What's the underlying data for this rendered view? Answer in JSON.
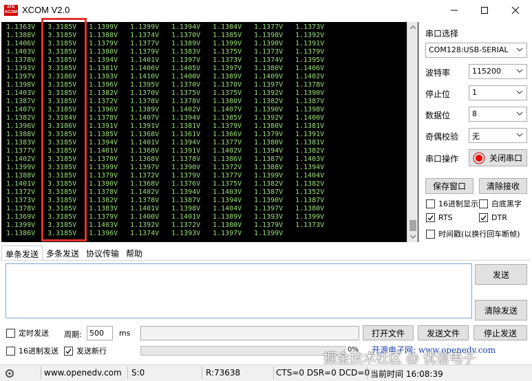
{
  "window": {
    "title": "XCOM V2.0",
    "logo_text": "ATK XCOM"
  },
  "terminal": {
    "rows": [
      [
        "1.1363V",
        "3.3185V",
        "1.1399V",
        "1.1399V",
        "1.1394V",
        "1.1384V",
        "1.1377V",
        "1.1373V"
      ],
      [
        "1.1388V",
        "3.3185V",
        "1.1388V",
        "1.1374V",
        "1.1370V",
        "1.1385V",
        "1.1398V",
        "1.1392V"
      ],
      [
        "1.1406V",
        "3.3185V",
        "1.1379V",
        "1.1377V",
        "1.1389V",
        "1.1399V",
        "1.1390V",
        "1.1391V"
      ],
      [
        "1.1403V",
        "3.3185V",
        "1.1380V",
        "1.1379V",
        "1.1383V",
        "1.1375V",
        "1.1373V",
        "1.1379V"
      ],
      [
        "1.1378V",
        "3.3185V",
        "1.1394V",
        "1.1401V",
        "1.1397V",
        "1.1373V",
        "1.1374V",
        "1.1395V"
      ],
      [
        "1.1393V",
        "3.3185V",
        "1.1381V",
        "1.1406V",
        "1.1405V",
        "1.1397V",
        "1.1380V",
        "1.1406V"
      ],
      [
        "1.1397V",
        "3.3186V",
        "1.1393V",
        "1.1410V",
        "1.1400V",
        "1.1389V",
        "1.1409V",
        "1.1402V"
      ],
      [
        "1.1398V",
        "3.3185V",
        "1.1396V",
        "1.1395V",
        "1.1370V",
        "1.1370V",
        "1.1397V",
        "1.1378V"
      ],
      [
        "1.1403V",
        "3.3185V",
        "1.1382V",
        "1.1370V",
        "1.1375V",
        "1.1375V",
        "1.1392V",
        "1.1390V"
      ],
      [
        "1.1387V",
        "3.3185V",
        "1.1372V",
        "1.1378V",
        "1.1378V",
        "1.1380V",
        "1.1382V",
        "1.1387V"
      ],
      [
        "1.1407V",
        "3.3185V",
        "1.1396V",
        "1.1389V",
        "1.1402V",
        "1.1407V",
        "1.1390V",
        "1.1398V"
      ],
      [
        "1.1382V",
        "3.3184V",
        "1.1378V",
        "1.1407V",
        "1.1394V",
        "1.1385V",
        "1.1392V",
        "1.1400V"
      ],
      [
        "1.1396V",
        "3.3186V",
        "1.1391V",
        "1.1391V",
        "1.1381V",
        "1.1379V",
        "1.1380V",
        "1.1381V"
      ],
      [
        "1.1388V",
        "3.3185V",
        "1.1385V",
        "1.1368V",
        "1.1361V",
        "1.1366V",
        "1.1379V",
        "1.1391V"
      ],
      [
        "1.1383V",
        "3.3185V",
        "1.1394V",
        "1.1401V",
        "1.1394V",
        "1.1377V",
        "1.1380V",
        "1.1381V"
      ],
      [
        "1.1377V",
        "3.3185V",
        "1.1401V",
        "1.1368V",
        "1.1391V",
        "1.1402V",
        "1.1394V",
        "1.1382V"
      ],
      [
        "1.1402V",
        "3.3185V",
        "1.1370V",
        "1.1368V",
        "1.1378V",
        "1.1386V",
        "1.1387V",
        "1.1403V"
      ],
      [
        "1.1399V",
        "3.3185V",
        "1.1399V",
        "1.1397V",
        "1.1390V",
        "1.1372V",
        "1.1388V",
        "1.1394V"
      ],
      [
        "1.1388V",
        "3.3185V",
        "1.1379V",
        "1.1372V",
        "1.1379V",
        "1.1377V",
        "1.1399V",
        "1.1404V"
      ],
      [
        "1.1401V",
        "3.3185V",
        "1.1390V",
        "1.1368V",
        "1.1376V",
        "1.1375V",
        "1.1382V",
        "1.1382V"
      ],
      [
        "1.1372V",
        "3.3185V",
        "1.1378V",
        "1.1402V",
        "1.1394V",
        "1.1403V",
        "1.1387V",
        "1.1352V"
      ],
      [
        "1.1373V",
        "3.3185V",
        "1.1382V",
        "1.1378V",
        "1.1387V",
        "1.1394V",
        "1.1390V",
        "1.1387V"
      ],
      [
        "1.1378V",
        "3.3185V",
        "1.1383V",
        "1.1401V",
        "1.1398V",
        "1.1404V",
        "1.1397V",
        "1.1380V"
      ],
      [
        "1.1369V",
        "3.3185V",
        "1.1379V",
        "1.1400V",
        "1.1401V",
        "1.1389V",
        "1.1393V",
        "1.1399V"
      ],
      [
        "1.1399V",
        "3.3185V",
        "1.1403V",
        "1.1392V",
        "1.1372V",
        "1.1380V",
        "1.1379V",
        "1.1373V"
      ],
      [
        "1.1386V",
        "3.3185V",
        "1.1396V",
        "1.1374V",
        "1.1393V",
        "1.1397V",
        "1.1399V",
        ""
      ]
    ],
    "text_color": "#9ce27a",
    "highlight_color": "#e5332b"
  },
  "side": {
    "port_select_label": "串口选择",
    "port_value": "COM128:USB-SERIAL",
    "baud_label": "波特率",
    "baud_value": "115200",
    "stopbit_label": "停止位",
    "stopbit_value": "1",
    "databit_label": "数据位",
    "databit_value": "8",
    "parity_label": "奇偶校验",
    "parity_value": "无",
    "port_op_label": "串口操作",
    "close_port_button": "关闭串口",
    "save_window_button": "保存窗口",
    "clear_receive_button": "清除接收",
    "hex_display": "16进制显示",
    "white_bg": "白底黑字",
    "rts": "RTS",
    "dtr": "DTR",
    "timestamp": "时间戳(以换行回车断帧)"
  },
  "tabs": [
    "单条发送",
    "多条发送",
    "协议传输",
    "帮助"
  ],
  "send": {
    "send_button": "发送",
    "clear_send_button": "清除发送",
    "timed_send": "定时发送",
    "period_label": "周期:",
    "period_value": "500",
    "period_unit": "ms",
    "open_file_button": "打开文件",
    "send_file_button": "发送文件",
    "stop_send_button": "停止发送",
    "hex_send": "16进制发送",
    "send_newline": "发送新行",
    "progress": "0%",
    "banner_text": "开源电子网: www.openedv.com"
  },
  "status": {
    "website": "www.openedv.com",
    "sent": "S:0",
    "received": "R:73638",
    "signals": "CTS=0 DSR=0 DCD=0",
    "time": "当前时间 16:08:39"
  },
  "watermark": "掘金技术社区 @ 优信电子"
}
